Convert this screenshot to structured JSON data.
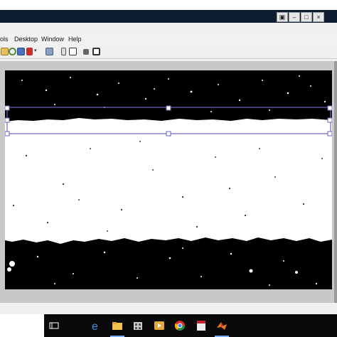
{
  "menubar": {
    "items": [
      "ols",
      "Desktop",
      "Window",
      "Help"
    ]
  },
  "toolbar": {
    "icons": [
      "open-icon",
      "rotate-icon",
      "brush-icon",
      "dropdown-icon",
      "print-icon",
      "phone-icon",
      "grid-icon",
      "square-icon",
      "fit-icon"
    ]
  },
  "colors": {
    "title_bg": "#0e1c30",
    "selection_color": "#6a66c0",
    "taskbar_bg": "#0a0a0a"
  },
  "taskbar": {
    "icons": [
      "task-view-icon",
      "edge-icon",
      "file-explorer-icon",
      "store-icon",
      "media-icon",
      "chrome-icon",
      "pdf-icon",
      "matlab-icon"
    ]
  }
}
